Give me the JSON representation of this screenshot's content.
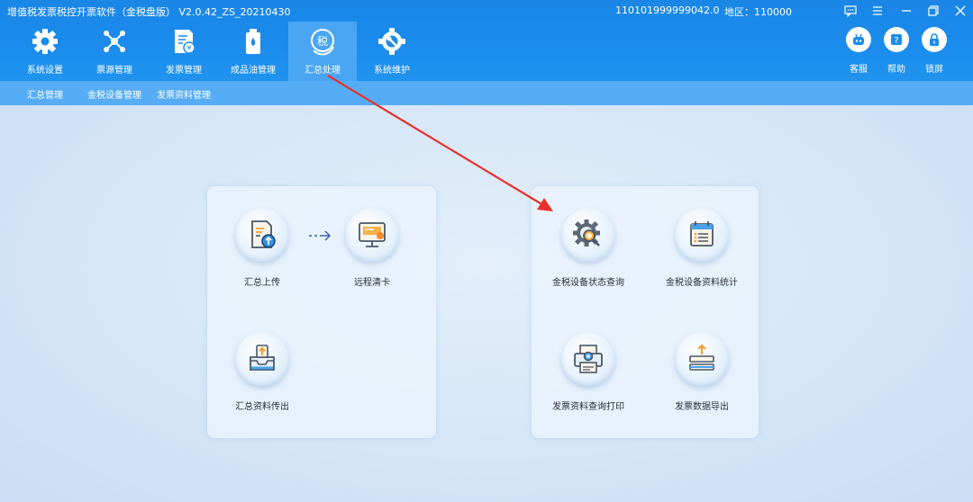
{
  "window": {
    "title": "增值税发票税控开票软件（金税盘版） V2.0.42_ZS_20210430",
    "tax_id": "110101999999042.0",
    "region": "地区：110000"
  },
  "nav": {
    "items": [
      {
        "label": "系统设置",
        "icon": "gear-icon"
      },
      {
        "label": "票源管理",
        "icon": "network-icon"
      },
      {
        "label": "发票管理",
        "icon": "invoice-icon"
      },
      {
        "label": "成品油管理",
        "icon": "oil-icon"
      },
      {
        "label": "汇总处理",
        "icon": "tax-summary-icon",
        "active": true
      },
      {
        "label": "系统维护",
        "icon": "wrench-gear-icon"
      }
    ]
  },
  "tools": [
    {
      "label": "客服",
      "icon": "robot-icon"
    },
    {
      "label": "帮助",
      "icon": "help-icon"
    },
    {
      "label": "锁屏",
      "icon": "lock-icon"
    }
  ],
  "subnav": [
    "汇总管理",
    "金税设备管理",
    "发票资料管理"
  ],
  "panels": {
    "left": {
      "tiles": [
        {
          "label": "汇总上传"
        },
        {
          "label": "远程清卡"
        },
        {
          "label": "汇总资料传出"
        }
      ]
    },
    "right": {
      "tiles": [
        {
          "label": "金税设备状态查询"
        },
        {
          "label": "金税设备资料统计"
        },
        {
          "label": "发票资料查询打印"
        },
        {
          "label": "发票数据导出"
        }
      ]
    }
  },
  "colors": {
    "header": "#1b8cec",
    "active_tab": "#4aa6f3",
    "subbar": "#57adf5",
    "annotation_arrow": "#e8312b"
  }
}
